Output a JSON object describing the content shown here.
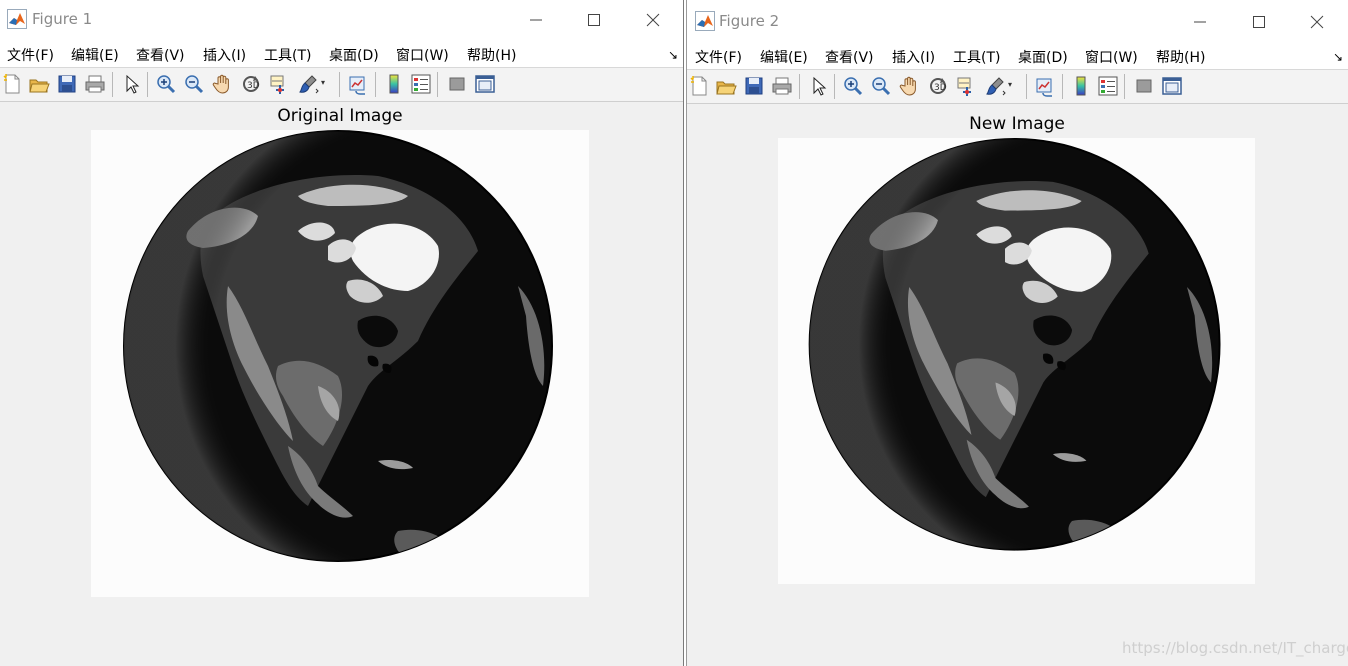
{
  "figure1": {
    "title": "Figure 1",
    "axes_title": "Original Image"
  },
  "figure2": {
    "title": "Figure 2",
    "axes_title": "New Image"
  },
  "menu": {
    "items": [
      "文件(F)",
      "编辑(E)",
      "查看(V)",
      "插入(I)",
      "工具(T)",
      "桌面(D)",
      "窗口(W)",
      "帮助(H)"
    ]
  },
  "toolbar_icons": [
    "new-figure-icon",
    "open-file-icon",
    "save-icon",
    "print-icon",
    "select-arrow-icon",
    "zoom-in-icon",
    "zoom-out-icon",
    "pan-hand-icon",
    "rotate-3d-icon",
    "data-cursor-icon",
    "brush-icon",
    "link-plot-icon",
    "colorbar-icon",
    "legend-icon",
    "hide-plot-tools-icon",
    "show-plot-tools-icon"
  ],
  "watermark": "https://blog.csdn.net/IT_charge",
  "colors": {
    "window_bg": "#f0f0f0",
    "titlebar_bg": "#ffffff",
    "title_text": "#8a8a8a",
    "image_bg": "#fcfcfc",
    "earth_dark": "#0b0b0b"
  }
}
